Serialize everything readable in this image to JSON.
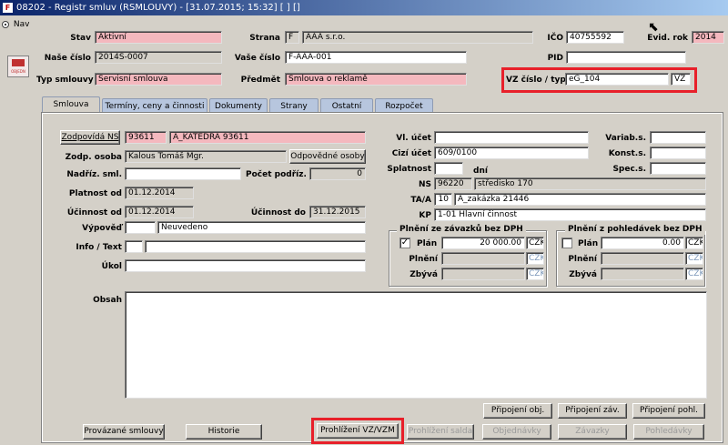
{
  "window": {
    "title": "08202 - Registr smluv (RSMLOUVY) - [31.07.2015; 15:32] [ ] []",
    "app_icon_label": "F"
  },
  "left": {
    "nav_label": "Nav",
    "image_label": "OBJEDN"
  },
  "header": {
    "stav_label": "Stav",
    "stav_value": "Aktivní",
    "strana_label": "Strana",
    "strana_code": "F",
    "strana_value": "AAA s.r.o.",
    "ico_label": "IČO",
    "ico_value": "40755592",
    "evid_rok_label": "Evid. rok",
    "evid_rok_value": "2014",
    "nase_cislo_label": "Naše číslo",
    "nase_cislo_value": "2014S-0007",
    "vase_cislo_label": "Vaše číslo",
    "vase_cislo_value": "F-AAA-001",
    "pid_label": "PID",
    "pid_value": "",
    "typ_smlouvy_label": "Typ smlouvy",
    "typ_smlouvy_value": "Servisní smlouva",
    "predmet_label": "Předmět",
    "predmet_value": "Smlouva o reklamě",
    "vz_label": "VZ číslo / typ",
    "vz_cislo_value": "eG_104",
    "vz_typ_value": "VZ"
  },
  "tabs": [
    {
      "label": "Smlouva"
    },
    {
      "label": "Termíny, ceny a činnosti"
    },
    {
      "label": "Dokumenty"
    },
    {
      "label": "Strany"
    },
    {
      "label": "Ostatní"
    },
    {
      "label": "Rozpočet"
    }
  ],
  "smlouva": {
    "zodpovida_button": "Zodpovídá NS",
    "zodpovida_code": "93611",
    "zodpovida_value": "A_KATEDRA 93611",
    "zodp_osoba_label": "Zodp. osoba",
    "zodp_osoba_value": "Kalous Tomáš Mgr.",
    "odpovedne_osoby_button": "Odpovědné osoby",
    "nadriz_label": "Nadříz. sml.",
    "nadriz_value": "",
    "pocet_podriz_label": "Počet podříz.",
    "pocet_podriz_value": "0",
    "platnost_od_label": "Platnost od",
    "platnost_od_value": "01.12.2014",
    "ucinnost_od_label": "Účinnost od",
    "ucinnost_od_value": "01.12.2014",
    "ucinnost_do_label": "Účinnost do",
    "ucinnost_do_value": "31.12.2015",
    "vypoved_label": "Výpověď",
    "vypoved_code": "",
    "vypoved_value": "Neuvedeno",
    "info_label": "Info / Text",
    "info_code": "",
    "info_value": "",
    "ukol_label": "Úkol",
    "ukol_value": "",
    "vl_ucet_label": "Vl. účet",
    "vl_ucet_value": "",
    "cizi_ucet_label": "Cizí účet",
    "cizi_ucet_value": "609/0100",
    "splatnost_label": "Splatnost",
    "splatnost_value": "",
    "dni_label": "dní",
    "variab_label": "Variab.s.",
    "variab_value": "",
    "konst_label": "Konst.s.",
    "konst_value": "",
    "spec_label": "Spec.s.",
    "spec_value": "",
    "ns_label": "NS",
    "ns_code": "96220",
    "ns_value": "středisko 170",
    "taa_label": "TA/A",
    "taa_code": "10",
    "taa_value": "A_zakázka 21446",
    "kp_label": "KP",
    "kp_value": "1-01 Hlavní činnost",
    "obsah_label": "Obsah",
    "obsah_value": ""
  },
  "plneni_zavazky": {
    "title": "Plnění ze závazků bez DPH",
    "plan_label": "Plán",
    "plan_checked": true,
    "plan_value": "20 000.00",
    "plan_cur": "CZK",
    "plneni_label": "Plnění",
    "plneni_value": "",
    "plneni_cur": "CZK",
    "zbyva_label": "Zbývá",
    "zbyva_value": "",
    "zbyva_cur": "CZK"
  },
  "plneni_pohledavky": {
    "title": "Plnění z pohledávek bez DPH",
    "plan_label": "Plán",
    "plan_checked": false,
    "plan_value": "0.00",
    "plan_cur": "CZK",
    "plneni_label": "Plnění",
    "plneni_value": "",
    "plneni_cur": "CZK",
    "zbyva_label": "Zbývá",
    "zbyva_value": "",
    "zbyva_cur": "CZK"
  },
  "buttons": {
    "pripojeni_obj": "Připojení obj.",
    "pripojeni_zav": "Připojení záv.",
    "pripojeni_pohl": "Připojení pohl.",
    "provazane_smlouvy": "Provázané smlouvy",
    "historie": "Historie",
    "prohlizeni_vz": "Prohlížení VZ/VZM",
    "prohlizeni_salda": "Prohlížení salda",
    "objednavky": "Objednávky",
    "zavazky": "Závazky",
    "pohledavky": "Pohledávky"
  },
  "colors": {
    "highlight_red": "#e8202a",
    "required_pink": "#f4b8be",
    "tab_blue": "#b7c6de"
  }
}
